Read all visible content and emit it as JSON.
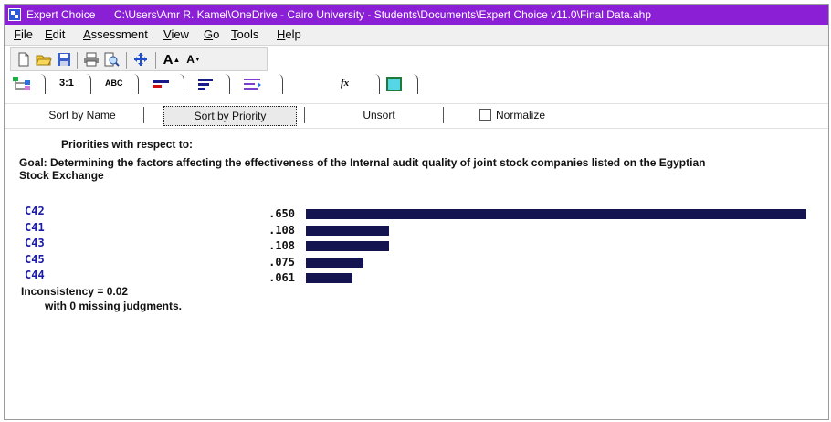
{
  "window": {
    "app_name": "Expert Choice",
    "path": "C:\\Users\\Amr R. Kamel\\OneDrive - Cairo University - Students\\Documents\\Expert Choice v11.0\\Final Data.ahp"
  },
  "menu": [
    {
      "label": "File",
      "key": "F",
      "rest": "ile"
    },
    {
      "label": "Edit",
      "key": "E",
      "rest": "dit"
    },
    {
      "label": "Assessment",
      "key": "A",
      "rest": "ssessment"
    },
    {
      "label": "View",
      "key": "V",
      "rest": "iew"
    },
    {
      "label": "Go",
      "key": "G",
      "rest": "o"
    },
    {
      "label": "Tools",
      "key": "T",
      "rest": "ools"
    },
    {
      "label": "Help",
      "key": "H",
      "rest": "elp"
    }
  ],
  "toolbar": {
    "icons": [
      "new-icon",
      "open-icon",
      "save-icon",
      "print-icon",
      "print-preview-icon",
      "navigate-icon",
      "font-larger-icon",
      "font-smaller-icon"
    ],
    "tabs": [
      {
        "icon": "tree-view-icon"
      },
      {
        "icon": "pairwise-numeric-icon",
        "text": "3:1"
      },
      {
        "icon": "pairwise-verbal-icon",
        "text": "ABC"
      },
      {
        "icon": "graphic-compare-icon"
      },
      {
        "icon": "questionnaire-icon"
      },
      {
        "icon": "direct-compare-icon"
      },
      {
        "icon": "formula-icon",
        "text": "fx"
      },
      {
        "icon": "rating-color-icon"
      }
    ]
  },
  "sort_bar": {
    "sort_by_name": "Sort by Name",
    "sort_by_priority": "Sort by Priority",
    "unsort": "Unsort",
    "normalize": "Normalize",
    "normalize_checked": false
  },
  "content": {
    "heading": "Priorities with respect to:",
    "goal": "Goal: Determining the factors affecting the effectiveness of the Internal audit quality of joint stock companies listed on the Egyptian Stock Exchange",
    "inconsistency": "Inconsistency = 0.02",
    "missing": "with 0  missing judgments."
  },
  "chart_data": {
    "type": "bar",
    "categories": [
      "C42",
      "C41",
      "C43",
      "C45",
      "C44"
    ],
    "values": [
      0.65,
      0.108,
      0.108,
      0.075,
      0.061
    ],
    "value_labels": [
      ".650",
      ".108",
      ".108",
      ".075",
      ".061"
    ],
    "bar_color": "#141450",
    "orientation": "horizontal"
  }
}
